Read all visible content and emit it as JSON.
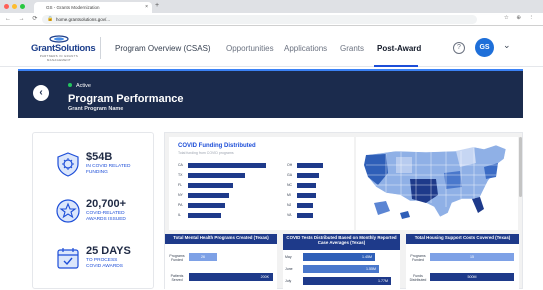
{
  "browser": {
    "tab_title": "GS - Grants Modernization",
    "url": "home.grantsolutions.gov/...",
    "nav_glyphs": "← → ⟳ ⌂",
    "ext_glyphs": "☆ ⊕ ⋮"
  },
  "header": {
    "logo_text": "GrantSolutions",
    "logo_sub": "PARTNERS IN GRANTS MANAGEMENT",
    "nav": {
      "program": "Program Overview (CSAS)",
      "opportunities": "Opportunities",
      "applications": "Applications",
      "grants": "Grants",
      "postaward": "Post-Award"
    },
    "help": "?",
    "user_initials": "GS",
    "menu_chevron": "⌄"
  },
  "banner": {
    "status": "Active",
    "title": "Program Performance",
    "subtitle": "Grant Program Name",
    "back_glyph": "‹"
  },
  "stats": [
    {
      "value": "$54B",
      "label_1": "IN COVID RELATED",
      "label_2": "FUNDING"
    },
    {
      "value": "20,700+",
      "label_1": "COVID-RELATED",
      "label_2": "AWARDS ISSUED"
    },
    {
      "value": "25 DAYS",
      "label_1": "TO PROCESS",
      "label_2": "COVID AWARDS"
    }
  ],
  "funding_chart": {
    "title": "COVID Funding Distributed",
    "subtitle": "Total funding from COVID programs"
  },
  "chart_data": {
    "type": "bar",
    "title": "COVID Funding Distributed",
    "series": [
      {
        "categories": [
          "CA",
          "TX",
          "FL",
          "NY",
          "PA",
          "IL"
        ],
        "values": [
          19,
          14,
          11,
          10,
          9,
          8
        ]
      },
      {
        "categories": [
          "OH",
          "GA",
          "NC",
          "MI",
          "NJ",
          "VA"
        ],
        "values": [
          8,
          7,
          6,
          6,
          5,
          5
        ]
      }
    ]
  },
  "panels": {
    "mental_health": {
      "title": "Total Mental Health Programs Created (Texas)",
      "row1_label": "Programs Funded",
      "row1_value": "26",
      "row2_label": "Patients Served",
      "row2_value": "200K"
    },
    "covid_tests": {
      "title": "COVID Tests Distributed Based on Monthly Reported Case Averages (Texas)",
      "rows": [
        {
          "label": "May",
          "value": "1.45M"
        },
        {
          "label": "June",
          "value": "1.55M"
        },
        {
          "label": "July",
          "value": "1.77M"
        }
      ]
    },
    "housing": {
      "title": "Total Housing Support Costs Covered (Texas)",
      "row1_label": "Programs Funded",
      "row1_value": "15",
      "row2_label": "Funds Distributed",
      "row2_value": "500M"
    }
  },
  "colors": {
    "navy": "#1b2b4d",
    "brand_blue": "#1e3a8a",
    "accent": "#1d4ed8",
    "light_bar": "#7ea1e6"
  }
}
